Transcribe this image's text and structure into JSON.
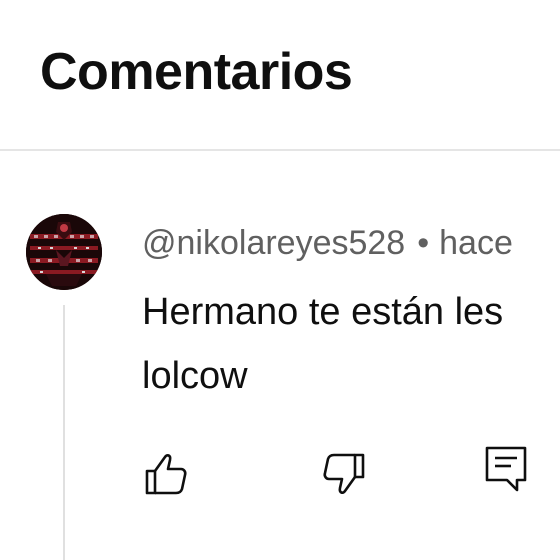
{
  "header": {
    "title": "Comentarios"
  },
  "comment": {
    "author": "@nikolareyes528",
    "separator": "•",
    "time": "hace",
    "text_lines": [
      "Hermano te están les",
      "lolcow"
    ],
    "actions": {
      "like_icon": "thumbs-up-icon",
      "dislike_icon": "thumbs-down-icon",
      "reply_icon": "reply-icon"
    }
  },
  "colors": {
    "text_primary": "#0f0f0f",
    "text_secondary": "#606060",
    "divider": "#e5e5e5"
  }
}
